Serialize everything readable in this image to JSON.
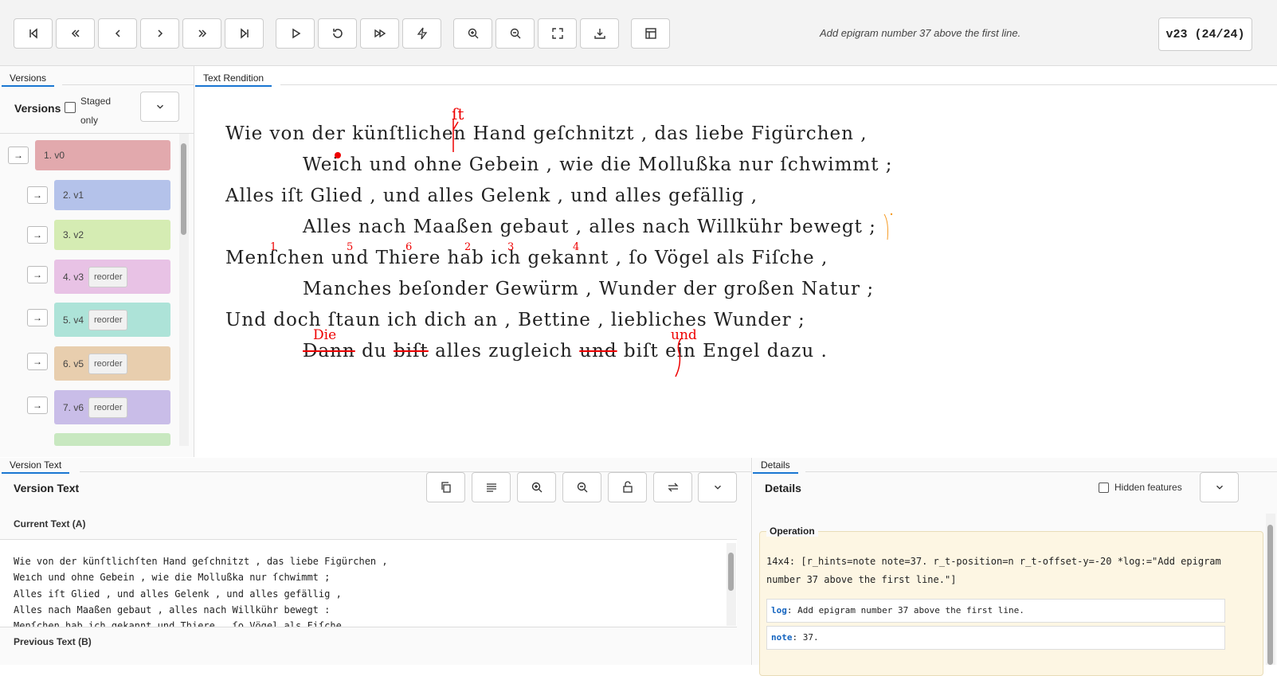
{
  "toolbar": {
    "buttons": [
      "first-icon",
      "fast-back-icon",
      "prev-icon",
      "next-icon",
      "fast-forward-icon",
      "last-icon",
      "play-icon",
      "reset-icon",
      "skip-forward-icon",
      "bolt-icon",
      "zoom-in-icon",
      "zoom-out-icon",
      "fullscreen-icon",
      "download-icon",
      "layout-icon"
    ],
    "log_message": "Add epigram number 37 above the first line.",
    "version_badge": "v23 (24/24)"
  },
  "versions_tab": {
    "tab_label": "Versions",
    "title": "Versions",
    "staged_label": "Staged only",
    "items": [
      {
        "label": "1. v0",
        "color": "#e2a9ad",
        "reorder": false
      },
      {
        "label": "2. v1",
        "color": "#b4c2ea",
        "reorder": false
      },
      {
        "label": "3. v2",
        "color": "#d5ecb3",
        "reorder": false
      },
      {
        "label": "4. v3",
        "color": "#e8c2e5",
        "reorder": true
      },
      {
        "label": "5. v4",
        "color": "#ade3d8",
        "reorder": true
      },
      {
        "label": "6. v5",
        "color": "#e8ceae",
        "reorder": true
      },
      {
        "label": "7. v6",
        "color": "#c9bde8",
        "reorder": true
      }
    ],
    "reorder_label": "reorder"
  },
  "rendition": {
    "tab_label": "Text Rendition",
    "lines": [
      "Wie von der künſtlichen Hand geſchnitzt , das liebe Figürchen ,",
      "Weich und ohne Gebein , wie die Mollußka nur ſchwimmt ;",
      "Alles iſt Glied , und alles Gelenk , und alles gefällig ,",
      "Alles nach Maaßen gebaut , alles nach Willkühr bewegt ;",
      "Menſchen und Thiere hab ich gekannt , ſo Vögel als Fiſche ,",
      "Manches beſonder Gewürm , Wunder der großen Natur ;",
      "Und doch ſtaun ich dich an , Bettine , liebliches Wunder ;"
    ],
    "last_line": {
      "dann": "Dann",
      "du": " du ",
      "bist1": "biſt",
      "mid": " alles zugleich ",
      "und": "und",
      "bist2": " biſt ",
      "end": "ein Engel dazu ."
    },
    "insert_st": "ſt",
    "insert_die": "Die",
    "insert_und": "und",
    "numbers": [
      "1",
      "5",
      "6",
      "2",
      "3",
      "4"
    ]
  },
  "version_text": {
    "tab_label": "Version Text",
    "title": "Version Text",
    "current_label": "Current Text (A)",
    "previous_label": "Previous Text (B)",
    "lines": [
      "Wie von der künſtlichſten Hand geſchnitzt , das liebe Figürchen ,",
      "Weıch und ohne Gebein , wie die Mollußka nur ſchwimmt ;",
      "Alles iſt Glied , und alles Gelenk , und alles gefällig ,",
      "Alles nach Maaßen gebaut , alles nach Willkühr bewegt :",
      "Menſchen hab ich gekannt und Thiere , ſo Vögel als Fiſche ,"
    ]
  },
  "details": {
    "tab_label": "Details",
    "title": "Details",
    "hidden_features": "Hidden features",
    "operation_label": "Operation",
    "operation_text": "14x4: [r_hints=note note=37. r_t-position=n r_t-offset-y=-20 *log:=\"Add epigram number 37 above the first line.\"]",
    "log_key": "log",
    "log_value": ": Add epigram number 37 above the first line.",
    "note_key": "note",
    "note_value": ": 37."
  }
}
